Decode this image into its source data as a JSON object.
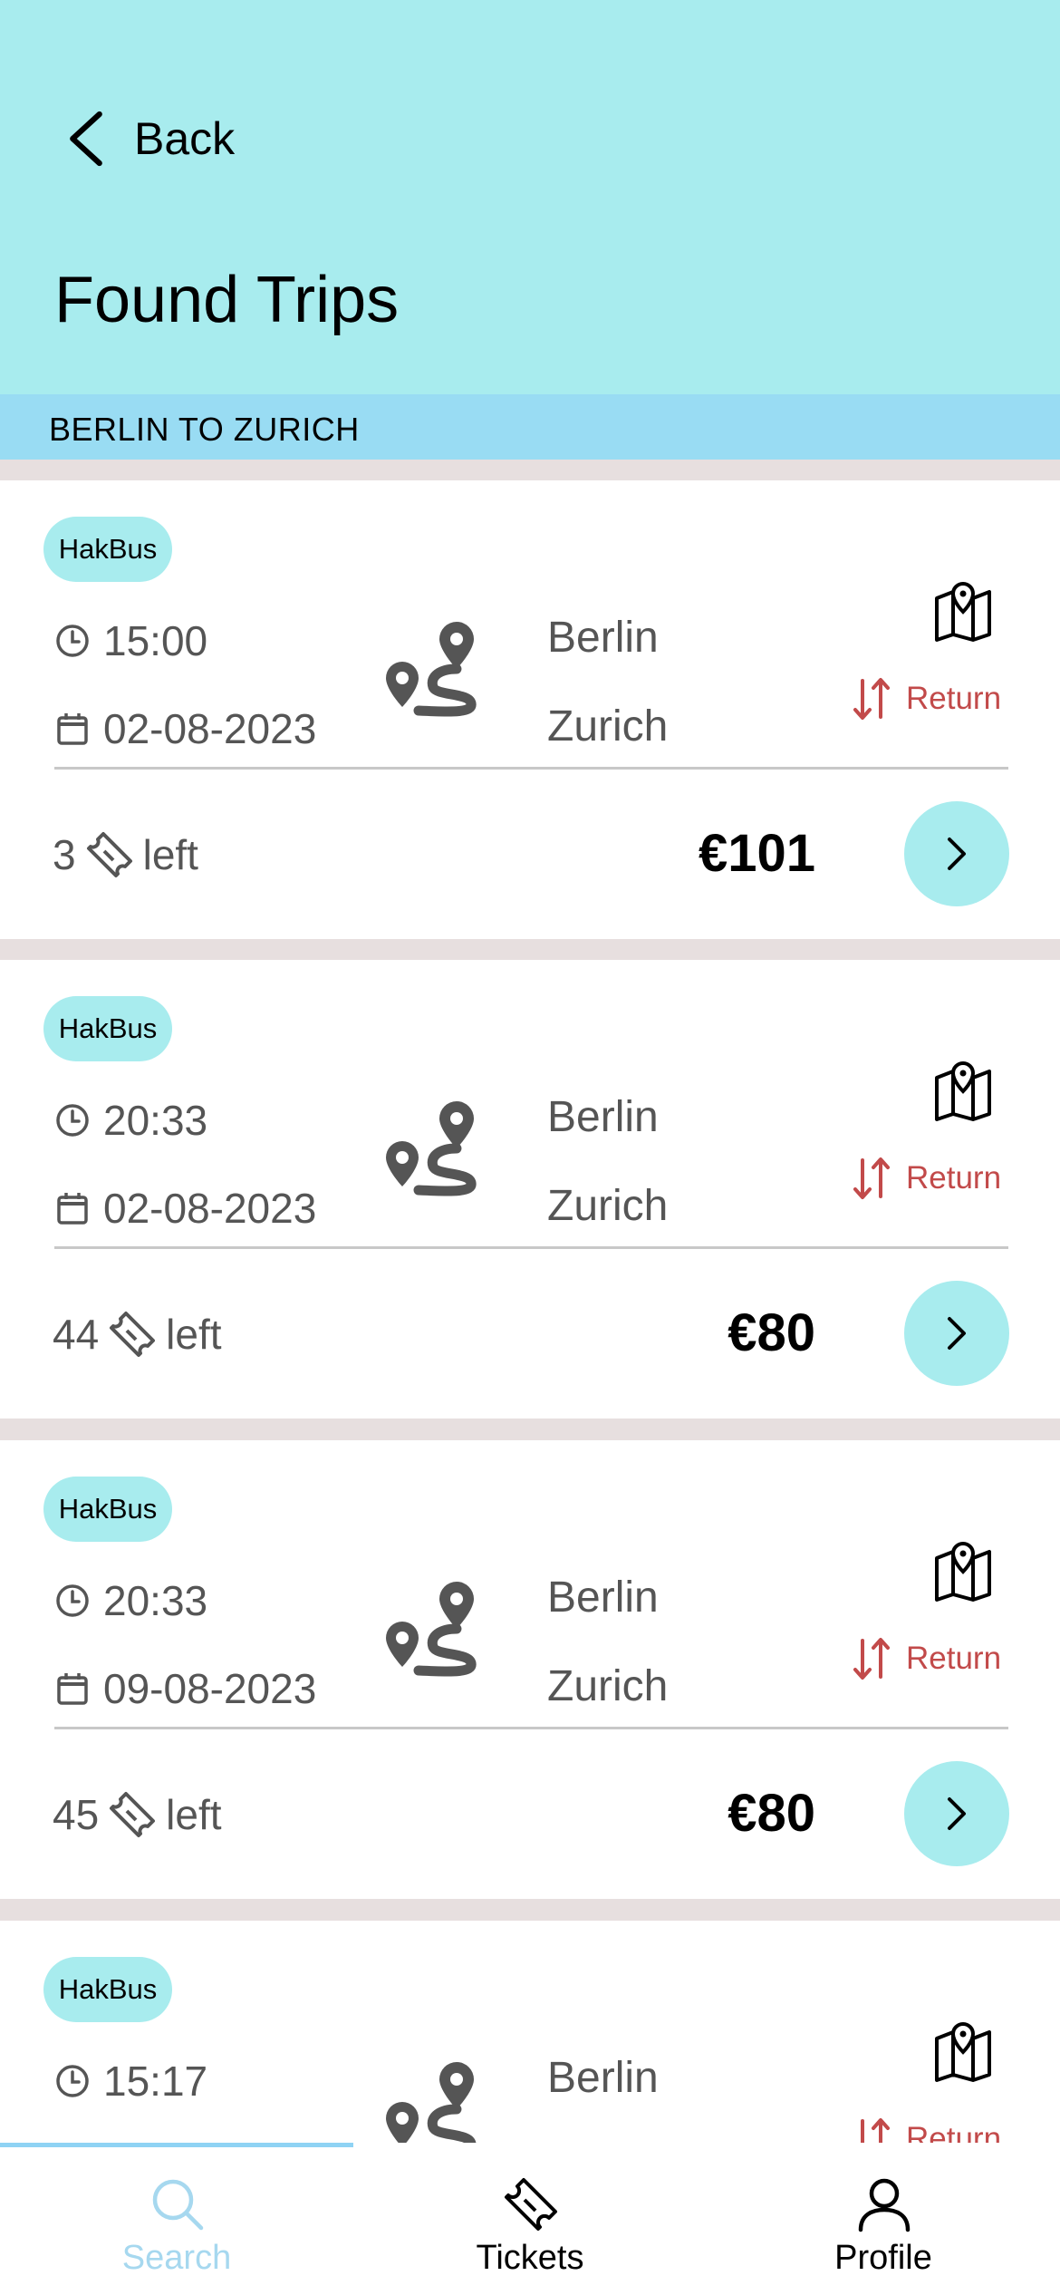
{
  "header": {
    "back_label": "Back",
    "title": "Found Trips",
    "route": "BERLIN TO ZURICH"
  },
  "trips": [
    {
      "operator": "HakBus",
      "time": "15:00",
      "date": "02-08-2023",
      "from": "Berlin",
      "to": "Zurich",
      "return_label": "Return",
      "seats_count": "3",
      "seats_suffix": "left",
      "price": "€101"
    },
    {
      "operator": "HakBus",
      "time": "20:33",
      "date": "02-08-2023",
      "from": "Berlin",
      "to": "Zurich",
      "return_label": "Return",
      "seats_count": "44",
      "seats_suffix": "left",
      "price": "€80"
    },
    {
      "operator": "HakBus",
      "time": "20:33",
      "date": "09-08-2023",
      "from": "Berlin",
      "to": "Zurich",
      "return_label": "Return",
      "seats_count": "45",
      "seats_suffix": "left",
      "price": "€80"
    },
    {
      "operator": "HakBus",
      "time": "15:17",
      "date": "",
      "from": "Berlin",
      "to": "",
      "return_label": "Return",
      "seats_count": "",
      "seats_suffix": "",
      "price": ""
    }
  ],
  "tabs": [
    {
      "label": "Search",
      "icon": "search-icon",
      "active": true
    },
    {
      "label": "Tickets",
      "icon": "ticket-icon",
      "active": false
    },
    {
      "label": "Profile",
      "icon": "user-icon",
      "active": false
    }
  ],
  "colors": {
    "header_bg": "#a8ecee",
    "banner_bg": "#99dcf3",
    "accent": "#a8ecee",
    "return_red": "#c24a4a",
    "active_tab": "#a6d8ef",
    "separator": "#e7dfdf"
  }
}
